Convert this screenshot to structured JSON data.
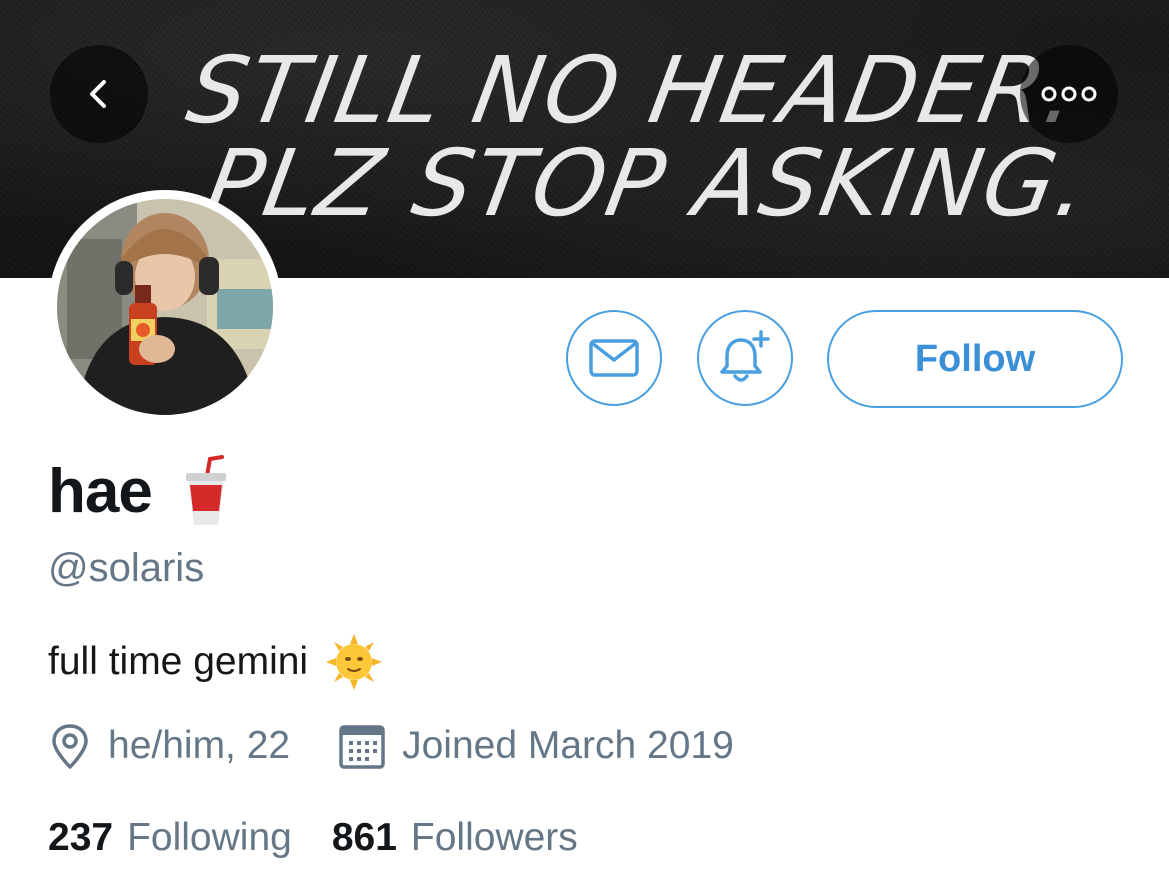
{
  "header": {
    "banner_line_1": "STILL NO HEADER.",
    "banner_line_2": "PLZ STOP ASKING.",
    "back_icon": "chevron-left-icon",
    "more_icon": "more-horizontal-icon"
  },
  "profile": {
    "display_name": "hae",
    "name_emoji": "cup-with-straw",
    "handle": "@solaris",
    "bio": "full time gemini",
    "bio_emoji": "sun-with-face",
    "location": "he/him, 22",
    "joined": "Joined March 2019"
  },
  "actions": {
    "message_icon": "mail-icon",
    "notify_icon": "bell-plus-icon",
    "follow_label": "Follow"
  },
  "stats": {
    "following_count": "237",
    "following_label": "Following",
    "followers_count": "861",
    "followers_label": "Followers"
  },
  "colors": {
    "accent": "#4a9fe0",
    "text_primary": "#14171a",
    "text_secondary": "#657786",
    "banner_bg": "#181818"
  }
}
